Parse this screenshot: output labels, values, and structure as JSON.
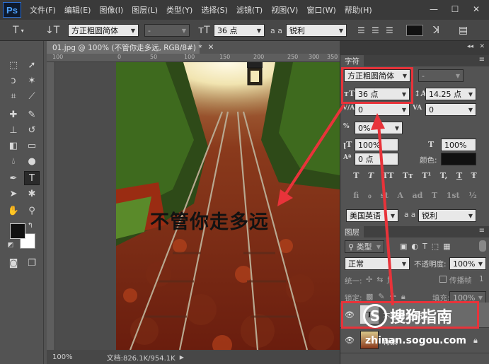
{
  "menu": [
    "文件(F)",
    "编辑(E)",
    "图像(I)",
    "图层(L)",
    "类型(Y)",
    "选择(S)",
    "滤镜(T)",
    "视图(V)",
    "窗口(W)",
    "帮助(H)"
  ],
  "app_logo": "Ps",
  "options_bar": {
    "font_family": "方正粗圆简体",
    "font_size": "36 点",
    "aa_label": "a a",
    "antialias": "锐利"
  },
  "document": {
    "tab_title": "01.jpg @ 100% (不管你走多远, RGB/8#) *",
    "ruler_labels": [
      "100",
      "0",
      "50",
      "100",
      "150",
      "200",
      "250",
      "300",
      "350"
    ],
    "overlay_text": "不管你走多远",
    "zoom": "100%",
    "doc_info": "文档:826.1K/954.1K"
  },
  "character_panel": {
    "tab": "字符",
    "font_family": "方正粗圆简体",
    "font_size": "36 点",
    "leading": "14.25 点",
    "kerning": "0",
    "tracking": "0",
    "scale_label": "0%",
    "vscale": "100%",
    "hscale": "100%",
    "baseline": "0 点",
    "color_label": "颜色:",
    "style_buttons": [
      "T",
      "T",
      "TT",
      "Tт",
      "T¹",
      "T,",
      "T",
      "Ŧ"
    ],
    "opentype_buttons": [
      "fi",
      "ℴ",
      "st",
      "A",
      "ad",
      "T",
      "1st",
      "½"
    ],
    "language": "美国英语",
    "aa_label": "a a",
    "antialias": "锐利"
  },
  "layers_panel": {
    "tab": "图层",
    "filter": "类型",
    "blend_mode": "正常",
    "opacity_label": "不透明度:",
    "opacity": "100%",
    "unify_label": "统一:",
    "propagate_label": "传播帧",
    "propagate_num": "1",
    "lock_label": "锁定:",
    "fill_label": "填充:",
    "fill": "100%",
    "layers": [
      {
        "name": "不管你走多远",
        "thumb": "T"
      },
      {
        "name": "背景"
      }
    ]
  },
  "watermark": {
    "logo": "S",
    "text": "搜狗指南",
    "url": "zhinan.sogou.com"
  },
  "colors": {
    "annotation_red": "#e8333a",
    "foreground": "#111111",
    "background": "#ffffff"
  }
}
